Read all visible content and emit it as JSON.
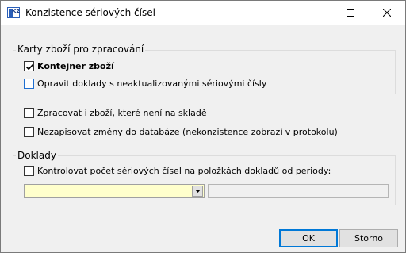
{
  "window": {
    "title": "Konzistence sériových čísel",
    "app_icon": "k2-app-icon",
    "app_icon_text": "K2",
    "controls": {
      "minimize_icon": "minimize-icon",
      "maximize_icon": "maximize-icon",
      "close_icon": "close-icon"
    }
  },
  "group_cards": {
    "legend": "Karty zboží pro zpracování",
    "items": [
      {
        "label": "Kontejner zboží",
        "checked": true,
        "bold": true
      },
      {
        "label": "Opravit doklady s neaktualizovanými sériovými čísly",
        "checked": false,
        "focused": true
      }
    ]
  },
  "options": [
    {
      "label": "Zpracovat i zboží, které není na skladě",
      "checked": false
    },
    {
      "label": "Nezapisovat změny do databáze (nekonzistence zobrazí v protokolu)",
      "checked": false
    }
  ],
  "group_documents": {
    "legend": "Doklady",
    "check": {
      "label": "Kontrolovat počet sériových čísel na položkách dokladů od periody:",
      "checked": false
    },
    "period_combo": {
      "value": "",
      "bg_color": "#ffffcc",
      "icon": "chevron-down-icon"
    },
    "period_field": {
      "value": ""
    }
  },
  "buttons": {
    "ok": "OK",
    "cancel": "Storno"
  },
  "colors": {
    "focus_border": "#1f6fd1",
    "default_button_border": "#0078d7",
    "dialog_bg": "#f0f0f0"
  }
}
